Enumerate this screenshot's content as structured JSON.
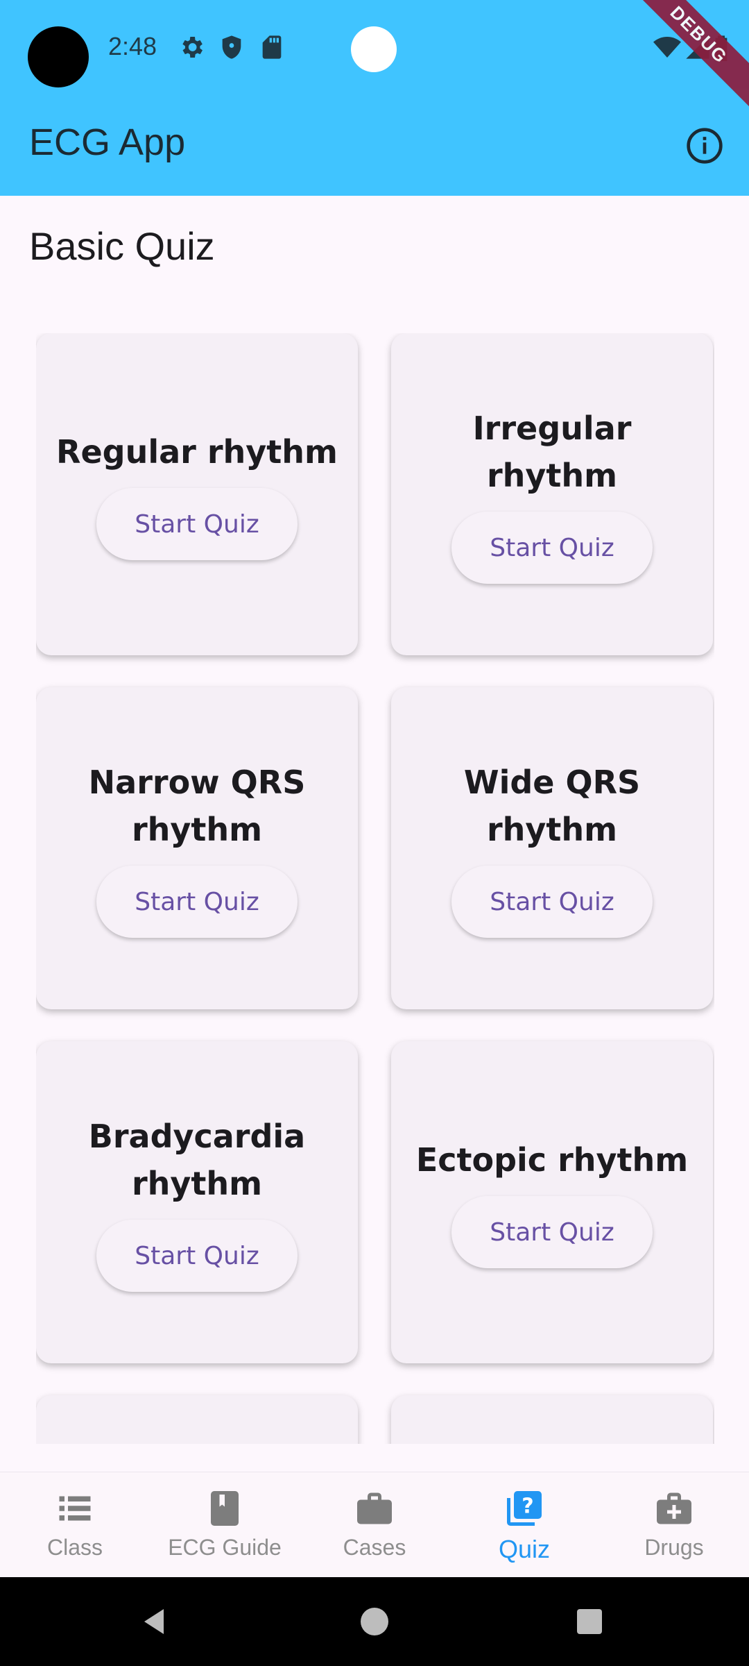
{
  "status_bar": {
    "time": "2:48",
    "icons": [
      "settings-icon",
      "shield-icon",
      "sd-card-icon",
      "wifi-icon",
      "signal-icon",
      "battery-icon"
    ],
    "debug_banner": "DEBUG"
  },
  "app_bar": {
    "title": "ECG App",
    "action_icon": "info-icon",
    "color": "#40c4ff"
  },
  "page": {
    "title": "Basic Quiz"
  },
  "quiz_cards": [
    {
      "title": "Regular rhythm",
      "button": "Start Quiz"
    },
    {
      "title": "Irregular rhythm",
      "button": "Start Quiz"
    },
    {
      "title": "Narrow QRS rhythm",
      "button": "Start Quiz"
    },
    {
      "title": "Wide QRS rhythm",
      "button": "Start Quiz"
    },
    {
      "title": "Bradycardia rhythm",
      "button": "Start Quiz"
    },
    {
      "title": "Ectopic rhythm",
      "button": "Start Quiz"
    }
  ],
  "bottom_nav": {
    "items": [
      {
        "label": "Class",
        "icon": "list-icon"
      },
      {
        "label": "ECG Guide",
        "icon": "book-icon"
      },
      {
        "label": "Cases",
        "icon": "briefcase-icon"
      },
      {
        "label": "Quiz",
        "icon": "quiz-icon"
      },
      {
        "label": "Drugs",
        "icon": "medical-bag-icon"
      }
    ],
    "active_index": 3,
    "active_color": "#2196f3"
  },
  "system_nav": {
    "buttons": [
      "back-icon",
      "home-icon",
      "recents-icon"
    ]
  }
}
